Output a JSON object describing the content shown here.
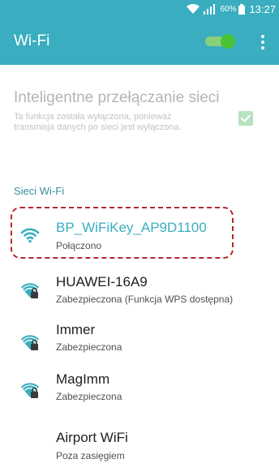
{
  "status_bar": {
    "battery_percent": "60%",
    "time": "13:27",
    "icons": [
      "wifi-icon",
      "signal-icon",
      "battery-icon"
    ]
  },
  "app_bar": {
    "title": "Wi-Fi",
    "wifi_enabled": true,
    "menu_icon": "more-vert-icon"
  },
  "smart_switch": {
    "title": "Inteligentne przełączanie sieci",
    "description": "Ta funkcja została wyłączona, ponieważ transmisja danych po sieci jest wyłączona.",
    "checked": true
  },
  "networks_header": "Sieci Wi-Fi",
  "networks": [
    {
      "name": "BP_WiFiKey_AP9D1100",
      "status": "Połączono",
      "icon": "wifi-connected-icon",
      "locked": false
    },
    {
      "name": "HUAWEI-16A9",
      "status": "Zabezpieczona (Funkcja WPS dostępna)",
      "icon": "wifi-locked-icon",
      "locked": true
    },
    {
      "name": "Immer",
      "status": "Zabezpieczona",
      "icon": "wifi-locked-icon",
      "locked": true
    },
    {
      "name": "MagImm",
      "status": "Zabezpieczona",
      "icon": "wifi-locked-icon",
      "locked": true
    },
    {
      "name": "Airport WiFi",
      "status": "Poza zasięgiem",
      "icon": "none",
      "locked": false
    }
  ],
  "colors": {
    "accent": "#3aaec0",
    "toggle_on": "#4cc237",
    "highlight_border": "#b8262c"
  }
}
